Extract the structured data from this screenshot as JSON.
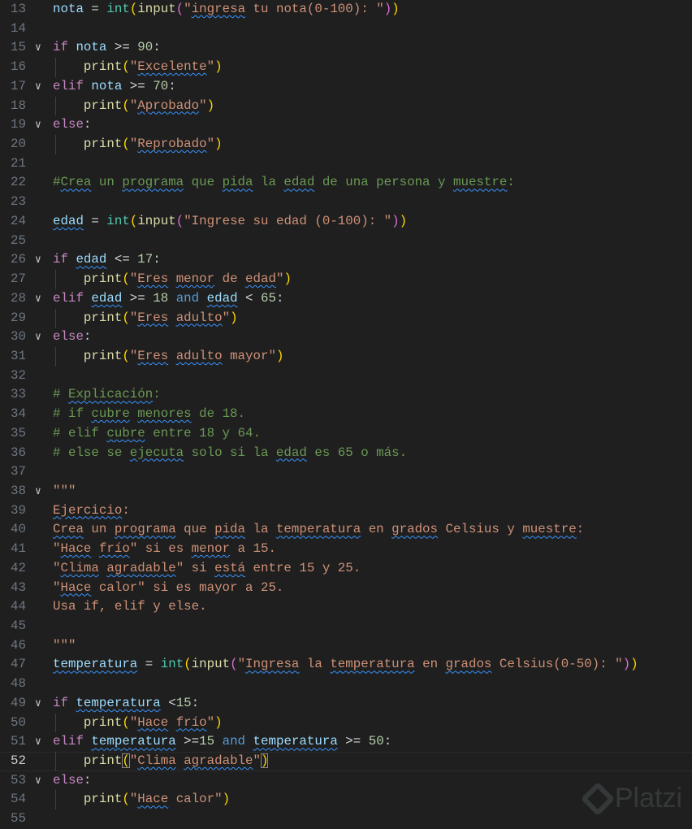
{
  "editor": {
    "current_line": 52,
    "watermark": "Platzi",
    "lines": [
      {
        "n": "13",
        "fold": false,
        "indent": false,
        "t": [
          [
            "v",
            "nota"
          ],
          [
            "o",
            " = "
          ],
          [
            "b",
            "int"
          ],
          [
            "p1",
            "("
          ],
          [
            "f",
            "input"
          ],
          [
            "p2",
            "("
          ],
          [
            "s",
            "\""
          ],
          [
            "s",
            "ingresa",
            1
          ],
          [
            "s",
            " tu nota(0-100): \""
          ],
          [
            "p2",
            ")"
          ],
          [
            "p1",
            ")"
          ]
        ]
      },
      {
        "n": "14",
        "fold": false,
        "indent": false,
        "t": []
      },
      {
        "n": "15",
        "fold": true,
        "indent": false,
        "t": [
          [
            "k",
            "if"
          ],
          [
            "o",
            " "
          ],
          [
            "v",
            "nota"
          ],
          [
            "o",
            " >= "
          ],
          [
            "n",
            "90"
          ],
          [
            "o",
            ":"
          ]
        ]
      },
      {
        "n": "16",
        "fold": false,
        "indent": true,
        "t": [
          [
            "o",
            "    "
          ],
          [
            "f",
            "print"
          ],
          [
            "p1",
            "("
          ],
          [
            "s",
            "\""
          ],
          [
            "s",
            "Excelente",
            1
          ],
          [
            "s",
            "\""
          ],
          [
            "p1",
            ")"
          ]
        ]
      },
      {
        "n": "17",
        "fold": true,
        "indent": false,
        "t": [
          [
            "k",
            "elif"
          ],
          [
            "o",
            " "
          ],
          [
            "v",
            "nota"
          ],
          [
            "o",
            " >= "
          ],
          [
            "n",
            "70"
          ],
          [
            "o",
            ":"
          ]
        ]
      },
      {
        "n": "18",
        "fold": false,
        "indent": true,
        "t": [
          [
            "o",
            "    "
          ],
          [
            "f",
            "print"
          ],
          [
            "p1",
            "("
          ],
          [
            "s",
            "\""
          ],
          [
            "s",
            "Aprobado",
            1
          ],
          [
            "s",
            "\""
          ],
          [
            "p1",
            ")"
          ]
        ]
      },
      {
        "n": "19",
        "fold": true,
        "indent": false,
        "t": [
          [
            "k",
            "else"
          ],
          [
            "o",
            ":"
          ]
        ]
      },
      {
        "n": "20",
        "fold": false,
        "indent": true,
        "t": [
          [
            "o",
            "    "
          ],
          [
            "f",
            "print"
          ],
          [
            "p1",
            "("
          ],
          [
            "s",
            "\""
          ],
          [
            "s",
            "Reprobado",
            1
          ],
          [
            "s",
            "\""
          ],
          [
            "p1",
            ")"
          ]
        ]
      },
      {
        "n": "21",
        "fold": false,
        "indent": false,
        "t": []
      },
      {
        "n": "22",
        "fold": false,
        "indent": false,
        "t": [
          [
            "c",
            "#"
          ],
          [
            "c",
            "Crea",
            1
          ],
          [
            "c",
            " un "
          ],
          [
            "c",
            "programa",
            1
          ],
          [
            "c",
            " que "
          ],
          [
            "c",
            "pida",
            1
          ],
          [
            "c",
            " la "
          ],
          [
            "c",
            "edad",
            1
          ],
          [
            "c",
            " de una persona y "
          ],
          [
            "c",
            "muestre",
            1
          ],
          [
            "c",
            ":"
          ]
        ]
      },
      {
        "n": "23",
        "fold": false,
        "indent": false,
        "t": []
      },
      {
        "n": "24",
        "fold": false,
        "indent": false,
        "t": [
          [
            "v",
            "edad",
            1
          ],
          [
            "o",
            " = "
          ],
          [
            "b",
            "int"
          ],
          [
            "p1",
            "("
          ],
          [
            "f",
            "input"
          ],
          [
            "p2",
            "("
          ],
          [
            "s",
            "\"Ingrese su edad (0-100): \""
          ],
          [
            "p2",
            ")"
          ],
          [
            "p1",
            ")"
          ]
        ]
      },
      {
        "n": "25",
        "fold": false,
        "indent": false,
        "t": []
      },
      {
        "n": "26",
        "fold": true,
        "indent": false,
        "t": [
          [
            "k",
            "if"
          ],
          [
            "o",
            " "
          ],
          [
            "v",
            "edad",
            1
          ],
          [
            "o",
            " <= "
          ],
          [
            "n",
            "17"
          ],
          [
            "o",
            ":"
          ]
        ]
      },
      {
        "n": "27",
        "fold": false,
        "indent": true,
        "t": [
          [
            "o",
            "    "
          ],
          [
            "f",
            "print"
          ],
          [
            "p1",
            "("
          ],
          [
            "s",
            "\""
          ],
          [
            "s",
            "Eres",
            1
          ],
          [
            "s",
            " "
          ],
          [
            "s",
            "menor",
            1
          ],
          [
            "s",
            " de "
          ],
          [
            "s",
            "edad",
            1
          ],
          [
            "s",
            "\""
          ],
          [
            "p1",
            ")"
          ]
        ]
      },
      {
        "n": "28",
        "fold": true,
        "indent": false,
        "t": [
          [
            "k",
            "elif"
          ],
          [
            "o",
            " "
          ],
          [
            "v",
            "edad",
            1
          ],
          [
            "o",
            " >= "
          ],
          [
            "n",
            "18"
          ],
          [
            "o",
            " "
          ],
          [
            "a",
            "and"
          ],
          [
            "o",
            " "
          ],
          [
            "v",
            "edad",
            1
          ],
          [
            "o",
            " < "
          ],
          [
            "n",
            "65"
          ],
          [
            "o",
            ":"
          ]
        ]
      },
      {
        "n": "29",
        "fold": false,
        "indent": true,
        "t": [
          [
            "o",
            "    "
          ],
          [
            "f",
            "print"
          ],
          [
            "p1",
            "("
          ],
          [
            "s",
            "\""
          ],
          [
            "s",
            "Eres",
            1
          ],
          [
            "s",
            " "
          ],
          [
            "s",
            "adulto",
            1
          ],
          [
            "s",
            "\""
          ],
          [
            "p1",
            ")"
          ]
        ]
      },
      {
        "n": "30",
        "fold": true,
        "indent": false,
        "t": [
          [
            "k",
            "else"
          ],
          [
            "o",
            ":"
          ]
        ]
      },
      {
        "n": "31",
        "fold": false,
        "indent": true,
        "t": [
          [
            "o",
            "    "
          ],
          [
            "f",
            "print"
          ],
          [
            "p1",
            "("
          ],
          [
            "s",
            "\""
          ],
          [
            "s",
            "Eres",
            1
          ],
          [
            "s",
            " "
          ],
          [
            "s",
            "adulto",
            1
          ],
          [
            "s",
            " mayor\""
          ],
          [
            "p1",
            ")"
          ]
        ]
      },
      {
        "n": "32",
        "fold": false,
        "indent": false,
        "t": []
      },
      {
        "n": "33",
        "fold": false,
        "indent": false,
        "t": [
          [
            "c",
            "# "
          ],
          [
            "c",
            "Explicación",
            1
          ],
          [
            "c",
            ":"
          ]
        ]
      },
      {
        "n": "34",
        "fold": false,
        "indent": false,
        "t": [
          [
            "c",
            "# if "
          ],
          [
            "c",
            "cubre",
            1
          ],
          [
            "c",
            " "
          ],
          [
            "c",
            "menores",
            1
          ],
          [
            "c",
            " de 18."
          ]
        ]
      },
      {
        "n": "35",
        "fold": false,
        "indent": false,
        "t": [
          [
            "c",
            "# elif "
          ],
          [
            "c",
            "cubre",
            1
          ],
          [
            "c",
            " entre 18 y 64."
          ]
        ]
      },
      {
        "n": "36",
        "fold": false,
        "indent": false,
        "t": [
          [
            "c",
            "# else se "
          ],
          [
            "c",
            "ejecuta",
            1
          ],
          [
            "c",
            " solo si la "
          ],
          [
            "c",
            "edad",
            1
          ],
          [
            "c",
            " es 65 o más."
          ]
        ]
      },
      {
        "n": "37",
        "fold": false,
        "indent": false,
        "t": []
      },
      {
        "n": "38",
        "fold": true,
        "indent": false,
        "t": [
          [
            "s",
            "\"\"\""
          ]
        ]
      },
      {
        "n": "39",
        "fold": false,
        "indent": false,
        "t": [
          [
            "s",
            "Ejercicio",
            1
          ],
          [
            "s",
            ":"
          ]
        ]
      },
      {
        "n": "40",
        "fold": false,
        "indent": false,
        "t": [
          [
            "s",
            "Crea",
            1
          ],
          [
            "s",
            " un "
          ],
          [
            "s",
            "programa",
            1
          ],
          [
            "s",
            " que "
          ],
          [
            "s",
            "pida",
            1
          ],
          [
            "s",
            " la "
          ],
          [
            "s",
            "temperatura",
            1
          ],
          [
            "s",
            " en "
          ],
          [
            "s",
            "grados",
            1
          ],
          [
            "s",
            " Celsius y "
          ],
          [
            "s",
            "muestre",
            1
          ],
          [
            "s",
            ":"
          ]
        ]
      },
      {
        "n": "41",
        "fold": false,
        "indent": false,
        "t": [
          [
            "s",
            "\""
          ],
          [
            "s",
            "Hace",
            1
          ],
          [
            "s",
            " "
          ],
          [
            "s",
            "frío",
            1
          ],
          [
            "s",
            "\" si es "
          ],
          [
            "s",
            "menor",
            1
          ],
          [
            "s",
            " a 15."
          ]
        ]
      },
      {
        "n": "42",
        "fold": false,
        "indent": false,
        "t": [
          [
            "s",
            "\""
          ],
          [
            "s",
            "Clima",
            1
          ],
          [
            "s",
            " "
          ],
          [
            "s",
            "agradable",
            1
          ],
          [
            "s",
            "\" si "
          ],
          [
            "s",
            "está",
            1
          ],
          [
            "s",
            " entre 15 y 25."
          ]
        ]
      },
      {
        "n": "43",
        "fold": false,
        "indent": false,
        "t": [
          [
            "s",
            "\""
          ],
          [
            "s",
            "Hace",
            1
          ],
          [
            "s",
            " calor\" si es mayor a 25."
          ]
        ]
      },
      {
        "n": "44",
        "fold": false,
        "indent": false,
        "t": [
          [
            "s",
            "Usa if, elif y else."
          ]
        ]
      },
      {
        "n": "45",
        "fold": false,
        "indent": false,
        "t": []
      },
      {
        "n": "46",
        "fold": false,
        "indent": false,
        "t": [
          [
            "s",
            "\"\"\""
          ]
        ]
      },
      {
        "n": "47",
        "fold": false,
        "indent": false,
        "t": [
          [
            "v",
            "temperatura",
            1
          ],
          [
            "o",
            " = "
          ],
          [
            "b",
            "int"
          ],
          [
            "p1",
            "("
          ],
          [
            "f",
            "input"
          ],
          [
            "p2",
            "("
          ],
          [
            "s",
            "\""
          ],
          [
            "s",
            "Ingresa",
            1
          ],
          [
            "s",
            " la "
          ],
          [
            "s",
            "temperatura",
            1
          ],
          [
            "s",
            " en "
          ],
          [
            "s",
            "grados",
            1
          ],
          [
            "s",
            " Celsius(0-50): \""
          ],
          [
            "p2",
            ")"
          ],
          [
            "p1",
            ")"
          ]
        ]
      },
      {
        "n": "48",
        "fold": false,
        "indent": false,
        "t": []
      },
      {
        "n": "49",
        "fold": true,
        "indent": false,
        "t": [
          [
            "k",
            "if"
          ],
          [
            "o",
            " "
          ],
          [
            "v",
            "temperatura",
            1
          ],
          [
            "o",
            " <"
          ],
          [
            "n",
            "15"
          ],
          [
            "o",
            ":"
          ]
        ]
      },
      {
        "n": "50",
        "fold": false,
        "indent": true,
        "t": [
          [
            "o",
            "    "
          ],
          [
            "f",
            "print"
          ],
          [
            "p1",
            "("
          ],
          [
            "s",
            "\""
          ],
          [
            "s",
            "Hace",
            1
          ],
          [
            "s",
            " "
          ],
          [
            "s",
            "frío",
            1
          ],
          [
            "s",
            "\""
          ],
          [
            "p1",
            ")"
          ]
        ]
      },
      {
        "n": "51",
        "fold": true,
        "indent": false,
        "t": [
          [
            "k",
            "elif"
          ],
          [
            "o",
            " "
          ],
          [
            "v",
            "temperatura",
            1
          ],
          [
            "o",
            " >="
          ],
          [
            "n",
            "15"
          ],
          [
            "o",
            " "
          ],
          [
            "a",
            "and"
          ],
          [
            "o",
            " "
          ],
          [
            "v",
            "temperatura",
            1
          ],
          [
            "o",
            " >= "
          ],
          [
            "n",
            "50"
          ],
          [
            "o",
            ":"
          ]
        ]
      },
      {
        "n": "52",
        "fold": false,
        "indent": true,
        "t": [
          [
            "o",
            "    "
          ],
          [
            "f",
            "print"
          ],
          [
            "p1",
            "("
          ],
          [
            "s",
            "\""
          ],
          [
            "s",
            "Clima",
            1
          ],
          [
            "s",
            " "
          ],
          [
            "s",
            "agradable",
            1
          ],
          [
            "s",
            "\""
          ],
          [
            "p1",
            ")"
          ]
        ]
      },
      {
        "n": "53",
        "fold": true,
        "indent": false,
        "t": [
          [
            "k",
            "else"
          ],
          [
            "o",
            ":"
          ]
        ]
      },
      {
        "n": "54",
        "fold": false,
        "indent": true,
        "t": [
          [
            "o",
            "    "
          ],
          [
            "f",
            "print"
          ],
          [
            "p1",
            "("
          ],
          [
            "s",
            "\""
          ],
          [
            "s",
            "Hace",
            1
          ],
          [
            "s",
            " calor\""
          ],
          [
            "p1",
            ")"
          ]
        ]
      },
      {
        "n": "55",
        "fold": false,
        "indent": false,
        "t": []
      }
    ]
  }
}
